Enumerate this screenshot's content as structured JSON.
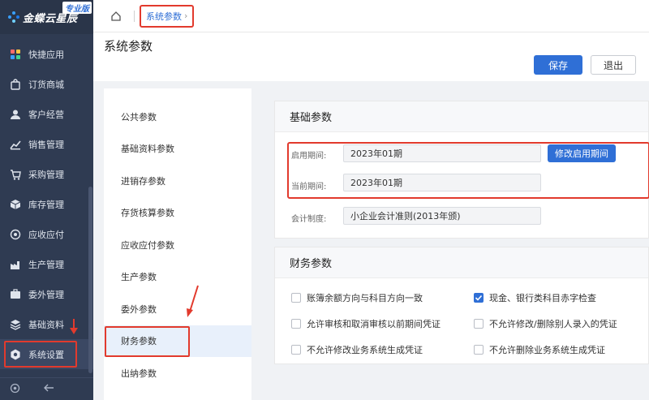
{
  "app": {
    "logo_text": "金蝶云星辰",
    "edition_badge": "专业版"
  },
  "sidebar": {
    "items": [
      {
        "label": "快捷应用",
        "icon": "grid-apps-icon"
      },
      {
        "label": "订货商城",
        "icon": "shopping-bag-icon"
      },
      {
        "label": "客户经营",
        "icon": "customer-icon"
      },
      {
        "label": "销售管理",
        "icon": "sales-chart-icon"
      },
      {
        "label": "采购管理",
        "icon": "cart-icon"
      },
      {
        "label": "库存管理",
        "icon": "box-icon"
      },
      {
        "label": "应收应付",
        "icon": "receivable-icon"
      },
      {
        "label": "生产管理",
        "icon": "factory-icon"
      },
      {
        "label": "委外管理",
        "icon": "outsourcing-icon"
      },
      {
        "label": "基础资料",
        "icon": "layers-icon"
      },
      {
        "label": "系统设置",
        "icon": "hexagon-gear-icon"
      }
    ]
  },
  "topbar": {
    "tab_label": "系统参数",
    "tab_chevron": "›"
  },
  "page": {
    "title": "系统参数",
    "save_label": "保存",
    "exit_label": "退出"
  },
  "menu": {
    "items": [
      "公共参数",
      "基础资料参数",
      "进销存参数",
      "存货核算参数",
      "应收应付参数",
      "生产参数",
      "委外参数",
      "财务参数",
      "出纳参数"
    ]
  },
  "basic": {
    "title": "基础参数",
    "start_label": "启用期间:",
    "start_value": "2023年01期",
    "modify_button": "修改启用期间",
    "current_label": "当前期间:",
    "current_value": "2023年01期",
    "system_label": "会计制度:",
    "system_value": "小企业会计准则(2013年颁)"
  },
  "finance": {
    "title": "财务参数",
    "options": [
      {
        "label": "账簿余额方向与科目方向一致",
        "checked": false
      },
      {
        "label": "现金、银行类科目赤字检查",
        "checked": true
      },
      {
        "label": "允许审核和取消审核以前期间凭证",
        "checked": false
      },
      {
        "label": "不允许修改/删除别人录入的凭证",
        "checked": false
      },
      {
        "label": "不允许修改业务系统生成凭证",
        "checked": false
      },
      {
        "label": "不允许删除业务系统生成凭证",
        "checked": false
      }
    ]
  },
  "colors": {
    "accent": "#2f6fd6",
    "sidebar_bg": "#2f3b52",
    "annotation_red": "#e23a2d"
  }
}
